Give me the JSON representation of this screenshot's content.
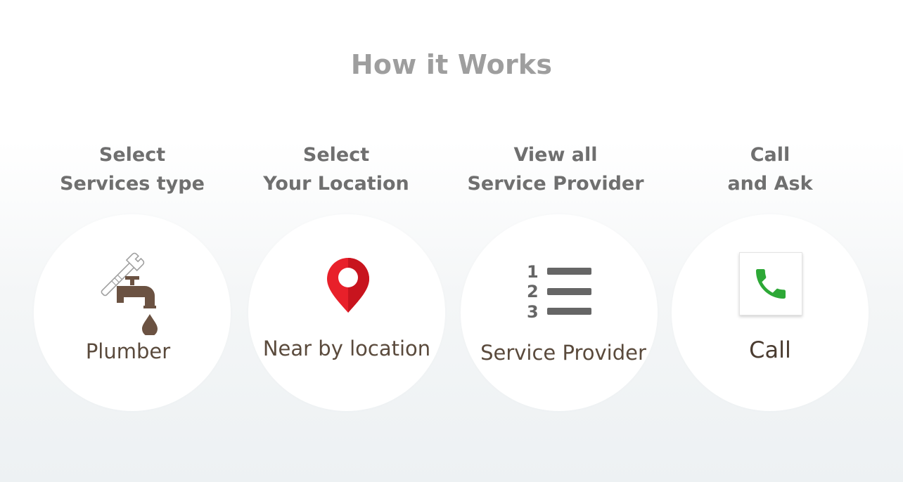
{
  "section": {
    "title": "How it Works"
  },
  "steps": [
    {
      "heading_line1": "Select",
      "heading_line2": "Services type",
      "label": "Plumber",
      "icon": "plumber-tap-icon"
    },
    {
      "heading_line1": "Select",
      "heading_line2": "Your Location",
      "label": "Near by location",
      "icon": "location-pin-icon"
    },
    {
      "heading_line1": "View all",
      "heading_line2": "Service Provider",
      "label": "Service Provider",
      "icon": "numbered-list-icon"
    },
    {
      "heading_line1": "Call",
      "heading_line2": "and Ask",
      "label": "Call",
      "icon": "phone-icon"
    }
  ],
  "colors": {
    "title": "#9e9e9e",
    "heading": "#6f6f6f",
    "label": "#5a4a3c",
    "pin": "#e8202a",
    "phone": "#2da836",
    "list": "#666666",
    "tap": "#6b5242"
  }
}
